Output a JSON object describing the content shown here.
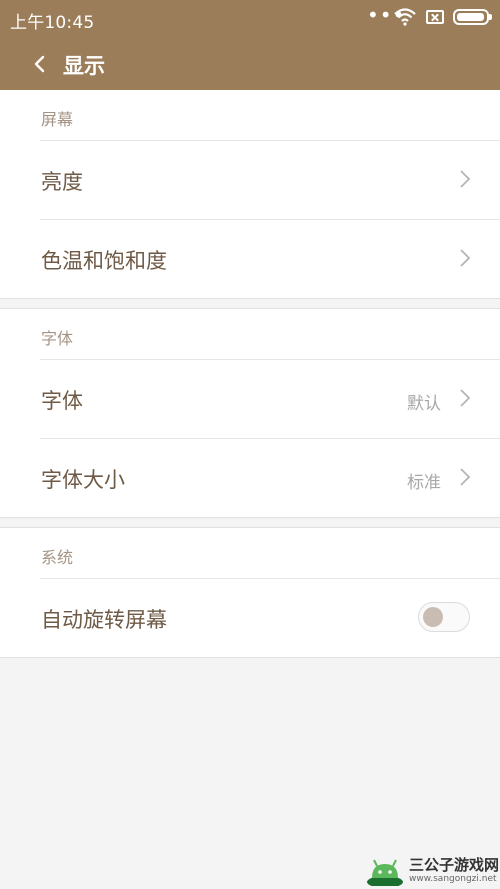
{
  "status_bar": {
    "time": "上午10:45",
    "dots": "•••",
    "icons": [
      "wifi-icon",
      "sim-icon",
      "battery-icon"
    ]
  },
  "header": {
    "title": "显示",
    "back_icon": "chevron-left-icon"
  },
  "sections": [
    {
      "title": "屏幕",
      "items": [
        {
          "label": "亮度",
          "value": ""
        },
        {
          "label": "色温和饱和度",
          "value": ""
        }
      ]
    },
    {
      "title": "字体",
      "items": [
        {
          "label": "字体",
          "value": "默认"
        },
        {
          "label": "字体大小",
          "value": "标准"
        }
      ]
    },
    {
      "title": "系统",
      "items": [
        {
          "label": "自动旋转屏幕",
          "toggle": false
        }
      ]
    }
  ],
  "watermark": {
    "title": "三公子游戏网",
    "url": "www.sangongzi.net"
  },
  "colors": {
    "header_bg": "#9b7d5a",
    "label_text": "#6e5a46",
    "section_title": "#a59484",
    "page_bg": "#f4f4f4"
  }
}
